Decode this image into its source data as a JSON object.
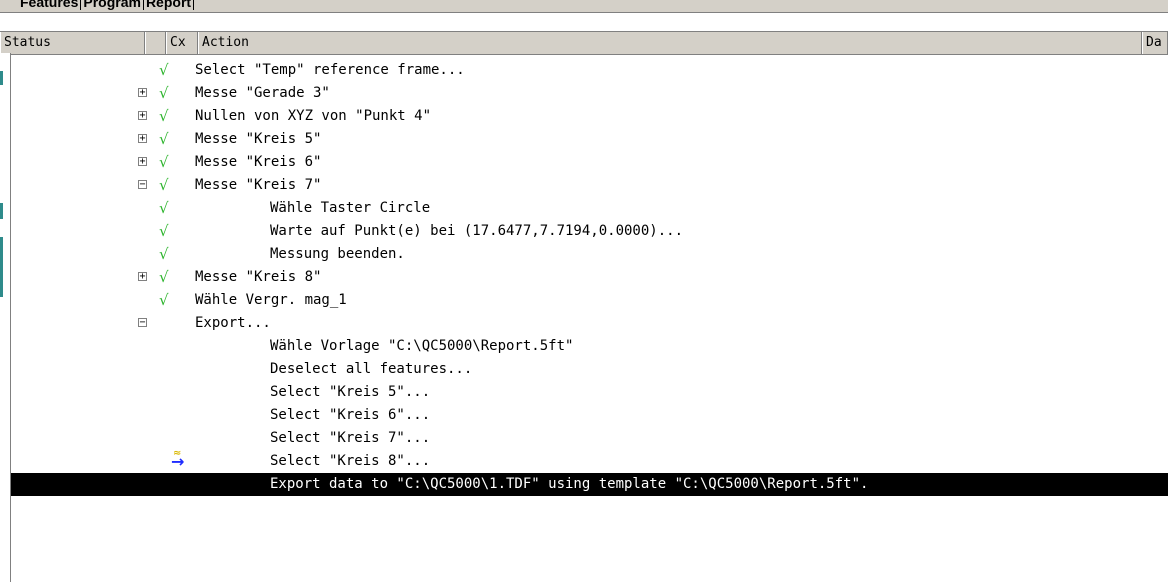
{
  "tabs": [
    "Features",
    "Program",
    "Report"
  ],
  "columns": {
    "status": "Status",
    "cx": "Cx",
    "action": "Action",
    "date": "Da"
  },
  "icons": {
    "check": "checkmark-icon",
    "plus": "expand-plus-icon",
    "minus": "collapse-minus-icon",
    "arrow": "current-step-arrow-icon"
  },
  "colors": {
    "check": "#2fb52f",
    "arrow": "#1f2cff",
    "selected_bg": "#000000"
  },
  "rows": [
    {
      "expander": "",
      "check": true,
      "level": 0,
      "text": "Select \"Temp\" reference frame..."
    },
    {
      "expander": "+",
      "check": true,
      "level": 0,
      "text": "Messe \"Gerade 3\""
    },
    {
      "expander": "+",
      "check": true,
      "level": 0,
      "text": "Nullen von XYZ von \"Punkt 4\""
    },
    {
      "expander": "+",
      "check": true,
      "level": 0,
      "text": "Messe \"Kreis 5\""
    },
    {
      "expander": "+",
      "check": true,
      "level": 0,
      "text": "Messe \"Kreis 6\""
    },
    {
      "expander": "−",
      "check": true,
      "level": 0,
      "text": "Messe \"Kreis 7\""
    },
    {
      "expander": "",
      "check": true,
      "level": 1,
      "text": "Wähle Taster Circle"
    },
    {
      "expander": "",
      "check": true,
      "level": 1,
      "text": "Warte auf Punkt(e) bei (17.6477,7.7194,0.0000)..."
    },
    {
      "expander": "",
      "check": true,
      "level": 1,
      "text": "Messung beenden."
    },
    {
      "expander": "+",
      "check": true,
      "level": 0,
      "text": "Messe \"Kreis 8\""
    },
    {
      "expander": "",
      "check": true,
      "level": 0,
      "text": "Wähle Vergr. mag_1"
    },
    {
      "expander": "−",
      "check": false,
      "level": 0,
      "text": "Export..."
    },
    {
      "expander": "",
      "check": false,
      "level": 1,
      "text": "Wähle Vorlage \"C:\\QC5000\\Report.5ft\""
    },
    {
      "expander": "",
      "check": false,
      "level": 1,
      "text": "Deselect all features..."
    },
    {
      "expander": "",
      "check": false,
      "level": 1,
      "text": "Select \"Kreis 5\"..."
    },
    {
      "expander": "",
      "check": false,
      "level": 1,
      "text": "Select \"Kreis 6\"..."
    },
    {
      "expander": "",
      "check": false,
      "level": 1,
      "text": "Select \"Kreis 7\"..."
    },
    {
      "expander": "",
      "check": false,
      "arrow": true,
      "level": 1,
      "text": "Select \"Kreis 8\"..."
    },
    {
      "expander": "",
      "check": false,
      "selected": true,
      "level": 1,
      "text": "Export data to \"C:\\QC5000\\1.TDF\" using template \"C:\\QC5000\\Report.5ft\"."
    }
  ]
}
